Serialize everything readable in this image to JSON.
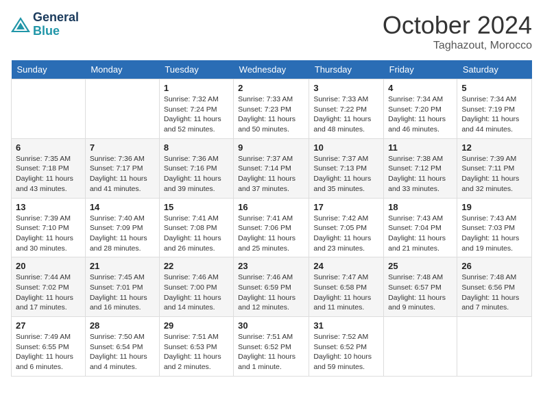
{
  "header": {
    "logo_line1": "General",
    "logo_line2": "Blue",
    "month": "October 2024",
    "location": "Taghazout, Morocco"
  },
  "weekdays": [
    "Sunday",
    "Monday",
    "Tuesday",
    "Wednesday",
    "Thursday",
    "Friday",
    "Saturday"
  ],
  "weeks": [
    [
      null,
      null,
      {
        "day": "1",
        "sunrise": "Sunrise: 7:32 AM",
        "sunset": "Sunset: 7:24 PM",
        "daylight": "Daylight: 11 hours and 52 minutes."
      },
      {
        "day": "2",
        "sunrise": "Sunrise: 7:33 AM",
        "sunset": "Sunset: 7:23 PM",
        "daylight": "Daylight: 11 hours and 50 minutes."
      },
      {
        "day": "3",
        "sunrise": "Sunrise: 7:33 AM",
        "sunset": "Sunset: 7:22 PM",
        "daylight": "Daylight: 11 hours and 48 minutes."
      },
      {
        "day": "4",
        "sunrise": "Sunrise: 7:34 AM",
        "sunset": "Sunset: 7:20 PM",
        "daylight": "Daylight: 11 hours and 46 minutes."
      },
      {
        "day": "5",
        "sunrise": "Sunrise: 7:34 AM",
        "sunset": "Sunset: 7:19 PM",
        "daylight": "Daylight: 11 hours and 44 minutes."
      }
    ],
    [
      {
        "day": "6",
        "sunrise": "Sunrise: 7:35 AM",
        "sunset": "Sunset: 7:18 PM",
        "daylight": "Daylight: 11 hours and 43 minutes."
      },
      {
        "day": "7",
        "sunrise": "Sunrise: 7:36 AM",
        "sunset": "Sunset: 7:17 PM",
        "daylight": "Daylight: 11 hours and 41 minutes."
      },
      {
        "day": "8",
        "sunrise": "Sunrise: 7:36 AM",
        "sunset": "Sunset: 7:16 PM",
        "daylight": "Daylight: 11 hours and 39 minutes."
      },
      {
        "day": "9",
        "sunrise": "Sunrise: 7:37 AM",
        "sunset": "Sunset: 7:14 PM",
        "daylight": "Daylight: 11 hours and 37 minutes."
      },
      {
        "day": "10",
        "sunrise": "Sunrise: 7:37 AM",
        "sunset": "Sunset: 7:13 PM",
        "daylight": "Daylight: 11 hours and 35 minutes."
      },
      {
        "day": "11",
        "sunrise": "Sunrise: 7:38 AM",
        "sunset": "Sunset: 7:12 PM",
        "daylight": "Daylight: 11 hours and 33 minutes."
      },
      {
        "day": "12",
        "sunrise": "Sunrise: 7:39 AM",
        "sunset": "Sunset: 7:11 PM",
        "daylight": "Daylight: 11 hours and 32 minutes."
      }
    ],
    [
      {
        "day": "13",
        "sunrise": "Sunrise: 7:39 AM",
        "sunset": "Sunset: 7:10 PM",
        "daylight": "Daylight: 11 hours and 30 minutes."
      },
      {
        "day": "14",
        "sunrise": "Sunrise: 7:40 AM",
        "sunset": "Sunset: 7:09 PM",
        "daylight": "Daylight: 11 hours and 28 minutes."
      },
      {
        "day": "15",
        "sunrise": "Sunrise: 7:41 AM",
        "sunset": "Sunset: 7:08 PM",
        "daylight": "Daylight: 11 hours and 26 minutes."
      },
      {
        "day": "16",
        "sunrise": "Sunrise: 7:41 AM",
        "sunset": "Sunset: 7:06 PM",
        "daylight": "Daylight: 11 hours and 25 minutes."
      },
      {
        "day": "17",
        "sunrise": "Sunrise: 7:42 AM",
        "sunset": "Sunset: 7:05 PM",
        "daylight": "Daylight: 11 hours and 23 minutes."
      },
      {
        "day": "18",
        "sunrise": "Sunrise: 7:43 AM",
        "sunset": "Sunset: 7:04 PM",
        "daylight": "Daylight: 11 hours and 21 minutes."
      },
      {
        "day": "19",
        "sunrise": "Sunrise: 7:43 AM",
        "sunset": "Sunset: 7:03 PM",
        "daylight": "Daylight: 11 hours and 19 minutes."
      }
    ],
    [
      {
        "day": "20",
        "sunrise": "Sunrise: 7:44 AM",
        "sunset": "Sunset: 7:02 PM",
        "daylight": "Daylight: 11 hours and 17 minutes."
      },
      {
        "day": "21",
        "sunrise": "Sunrise: 7:45 AM",
        "sunset": "Sunset: 7:01 PM",
        "daylight": "Daylight: 11 hours and 16 minutes."
      },
      {
        "day": "22",
        "sunrise": "Sunrise: 7:46 AM",
        "sunset": "Sunset: 7:00 PM",
        "daylight": "Daylight: 11 hours and 14 minutes."
      },
      {
        "day": "23",
        "sunrise": "Sunrise: 7:46 AM",
        "sunset": "Sunset: 6:59 PM",
        "daylight": "Daylight: 11 hours and 12 minutes."
      },
      {
        "day": "24",
        "sunrise": "Sunrise: 7:47 AM",
        "sunset": "Sunset: 6:58 PM",
        "daylight": "Daylight: 11 hours and 11 minutes."
      },
      {
        "day": "25",
        "sunrise": "Sunrise: 7:48 AM",
        "sunset": "Sunset: 6:57 PM",
        "daylight": "Daylight: 11 hours and 9 minutes."
      },
      {
        "day": "26",
        "sunrise": "Sunrise: 7:48 AM",
        "sunset": "Sunset: 6:56 PM",
        "daylight": "Daylight: 11 hours and 7 minutes."
      }
    ],
    [
      {
        "day": "27",
        "sunrise": "Sunrise: 7:49 AM",
        "sunset": "Sunset: 6:55 PM",
        "daylight": "Daylight: 11 hours and 6 minutes."
      },
      {
        "day": "28",
        "sunrise": "Sunrise: 7:50 AM",
        "sunset": "Sunset: 6:54 PM",
        "daylight": "Daylight: 11 hours and 4 minutes."
      },
      {
        "day": "29",
        "sunrise": "Sunrise: 7:51 AM",
        "sunset": "Sunset: 6:53 PM",
        "daylight": "Daylight: 11 hours and 2 minutes."
      },
      {
        "day": "30",
        "sunrise": "Sunrise: 7:51 AM",
        "sunset": "Sunset: 6:52 PM",
        "daylight": "Daylight: 11 hours and 1 minute."
      },
      {
        "day": "31",
        "sunrise": "Sunrise: 7:52 AM",
        "sunset": "Sunset: 6:52 PM",
        "daylight": "Daylight: 10 hours and 59 minutes."
      },
      null,
      null
    ]
  ]
}
